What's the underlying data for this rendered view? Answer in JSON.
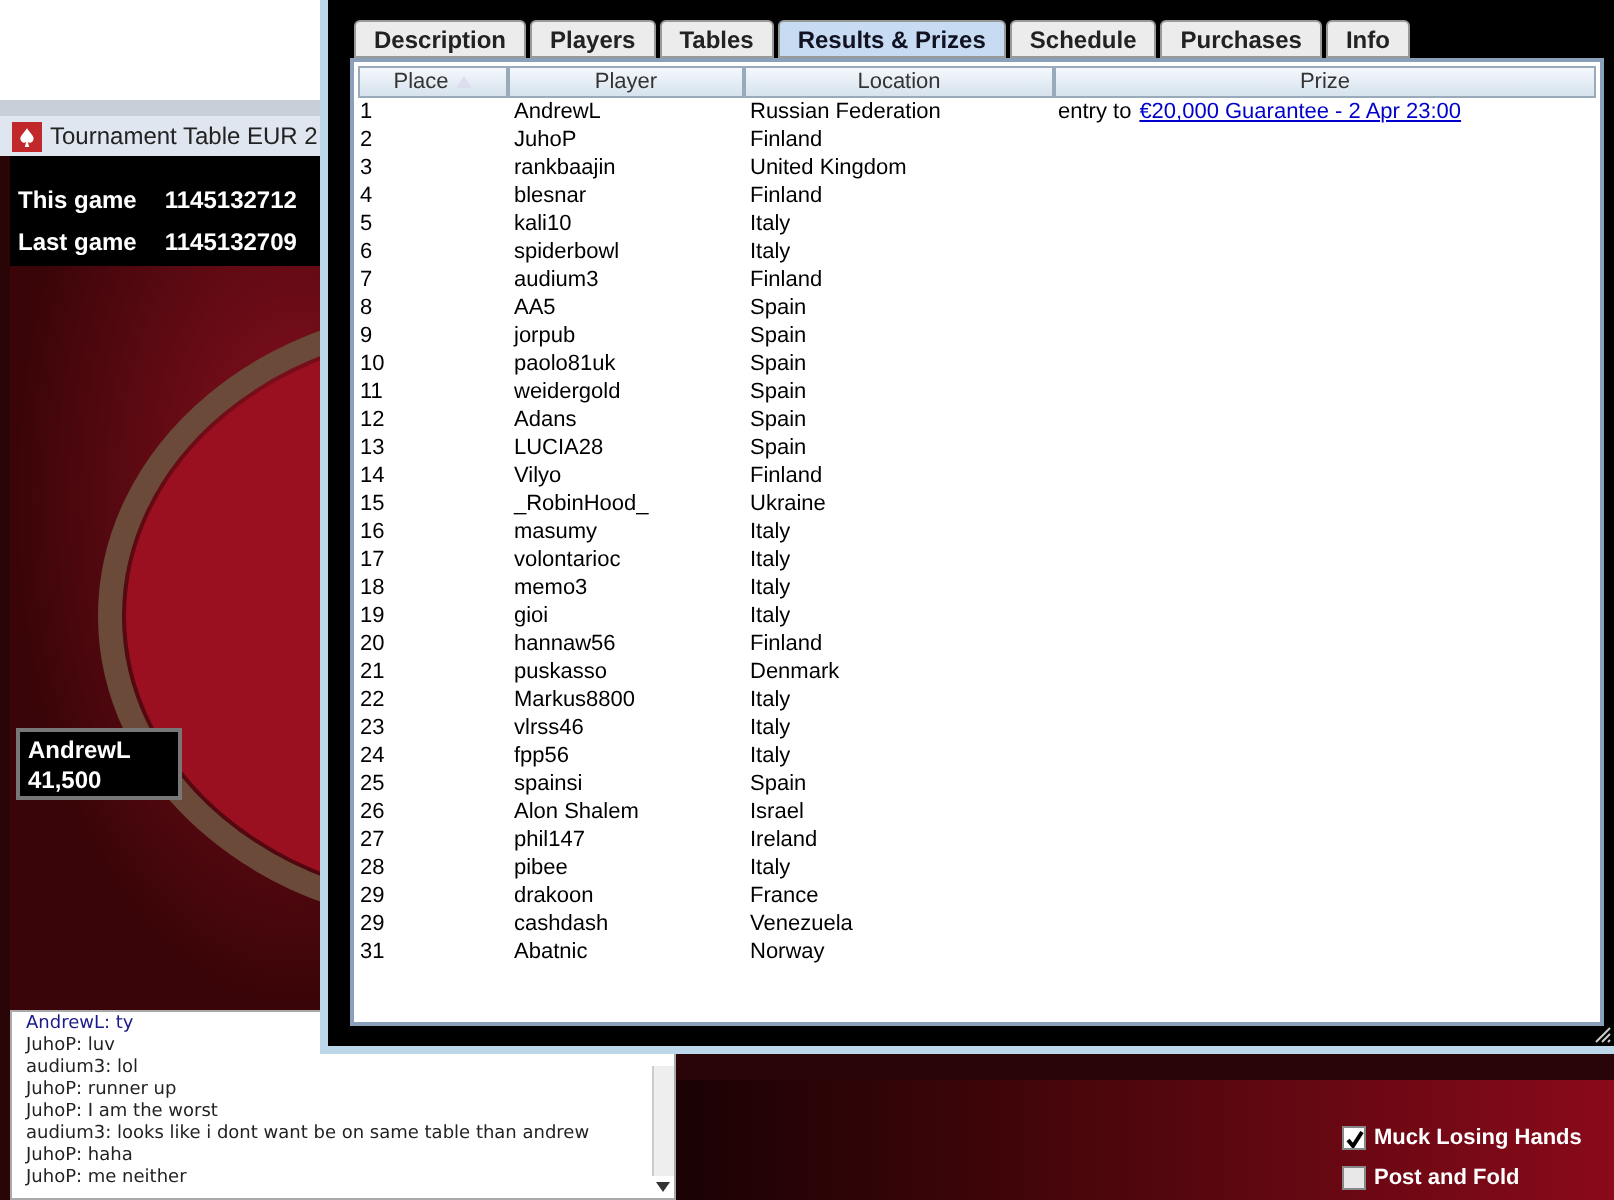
{
  "table_window": {
    "title": "Tournament Table EUR 2",
    "info": [
      {
        "label": "This game",
        "value": "1145132712"
      },
      {
        "label": "Last game",
        "value": "1145132709"
      }
    ],
    "player": {
      "name": "AndrewL",
      "chips": "41,500"
    },
    "chat": [
      {
        "text": "AndrewL: ty",
        "kind": "own"
      },
      {
        "text": "JuhoP: luv",
        "kind": "other"
      },
      {
        "text": "audium3: lol",
        "kind": "other"
      },
      {
        "text": "JuhoP: runner up",
        "kind": "other"
      },
      {
        "text": "JuhoP: I am the worst",
        "kind": "other"
      },
      {
        "text": "audium3: looks like i dont want be on same table than andrew",
        "kind": "other"
      },
      {
        "text": "JuhoP: haha",
        "kind": "other"
      },
      {
        "text": "JuhoP: me neither",
        "kind": "other"
      }
    ],
    "options": [
      {
        "label": "Muck Losing Hands",
        "checked": true
      },
      {
        "label": "Post and Fold",
        "checked": false
      }
    ]
  },
  "lobby": {
    "tabs": [
      {
        "label": "Description",
        "selected": false
      },
      {
        "label": "Players",
        "selected": false
      },
      {
        "label": "Tables",
        "selected": false
      },
      {
        "label": "Results & Prizes",
        "selected": true
      },
      {
        "label": "Schedule",
        "selected": false
      },
      {
        "label": "Purchases",
        "selected": false
      },
      {
        "label": "Info",
        "selected": false
      }
    ],
    "columns": [
      "Place",
      "Player",
      "Location",
      "Prize"
    ],
    "rows": [
      {
        "place": "1",
        "player": "AndrewL",
        "location": "Russian Federation",
        "prize_text": "entry to",
        "prize_link": "€20,000 Guarantee - 2 Apr 23:00"
      },
      {
        "place": "2",
        "player": "JuhoP",
        "location": "Finland"
      },
      {
        "place": "3",
        "player": "rankbaajin",
        "location": "United Kingdom"
      },
      {
        "place": "4",
        "player": "blesnar",
        "location": "Finland"
      },
      {
        "place": "5",
        "player": "kali10",
        "location": "Italy"
      },
      {
        "place": "6",
        "player": "spiderbowl",
        "location": "Italy"
      },
      {
        "place": "7",
        "player": "audium3",
        "location": "Finland"
      },
      {
        "place": "8",
        "player": "AA5",
        "location": "Spain"
      },
      {
        "place": "9",
        "player": "jorpub",
        "location": "Spain"
      },
      {
        "place": "10",
        "player": "paolo81uk",
        "location": "Spain"
      },
      {
        "place": "11",
        "player": "weidergold",
        "location": "Spain"
      },
      {
        "place": "12",
        "player": "Adans",
        "location": "Spain"
      },
      {
        "place": "13",
        "player": "LUCIA28",
        "location": "Spain"
      },
      {
        "place": "14",
        "player": "Vilyo",
        "location": "Finland"
      },
      {
        "place": "15",
        "player": "_RobinHood_",
        "location": "Ukraine"
      },
      {
        "place": "16",
        "player": "masumy",
        "location": "Italy"
      },
      {
        "place": "17",
        "player": "volontarioc",
        "location": "Italy"
      },
      {
        "place": "18",
        "player": "memo3",
        "location": "Italy"
      },
      {
        "place": "19",
        "player": "gioi",
        "location": "Italy"
      },
      {
        "place": "20",
        "player": "hannaw56",
        "location": "Finland"
      },
      {
        "place": "21",
        "player": "puskasso",
        "location": "Denmark"
      },
      {
        "place": "22",
        "player": "Markus8800",
        "location": "Italy"
      },
      {
        "place": "23",
        "player": "vlrss46",
        "location": "Italy"
      },
      {
        "place": "24",
        "player": "fpp56",
        "location": "Italy"
      },
      {
        "place": "25",
        "player": "spainsi",
        "location": "Spain"
      },
      {
        "place": "26",
        "player": "Alon Shalem",
        "location": "Israel"
      },
      {
        "place": "27",
        "player": "phil147",
        "location": "Ireland"
      },
      {
        "place": "28",
        "player": "pibee",
        "location": "Italy"
      },
      {
        "place": "29",
        "player": "drakoon",
        "location": "France"
      },
      {
        "place": "29",
        "player": "cashdash",
        "location": "Venezuela"
      },
      {
        "place": "31",
        "player": "Abatnic",
        "location": "Norway"
      }
    ]
  }
}
